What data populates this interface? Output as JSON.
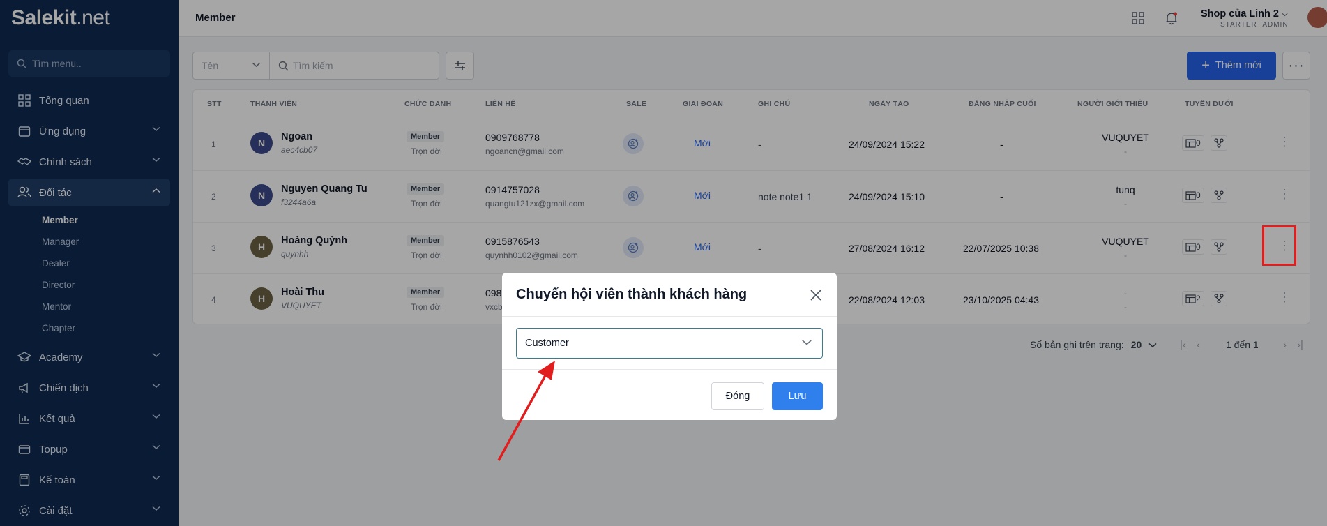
{
  "brand": {
    "logo_main": "Salekit",
    "logo_suffix": ".net"
  },
  "sidebar": {
    "search_placeholder": "Tìm menu..",
    "items": [
      {
        "label": "Tổng quan"
      },
      {
        "label": "Ứng dụng"
      },
      {
        "label": "Chính sách"
      },
      {
        "label": "Đối tác"
      },
      {
        "label": "Academy"
      },
      {
        "label": "Chiến dịch"
      },
      {
        "label": "Kết quả"
      },
      {
        "label": "Topup"
      },
      {
        "label": "Kế toán"
      },
      {
        "label": "Cài đặt"
      }
    ],
    "submenu": [
      "Member",
      "Manager",
      "Dealer",
      "Director",
      "Mentor",
      "Chapter"
    ]
  },
  "header": {
    "title": "Member",
    "shop_name": "Shop của Linh 2",
    "plan": "STARTER",
    "role": "ADMIN"
  },
  "toolbar": {
    "filter_field": "Tên",
    "search_placeholder": "Tìm kiếm",
    "add_label": "Thêm mới"
  },
  "table": {
    "columns": [
      "STT",
      "THÀNH VIÊN",
      "CHỨC DANH",
      "LIÊN HỆ",
      "SALE",
      "GIAI ĐOẠN",
      "GHI CHÚ",
      "NGÀY TẠO",
      "ĐĂNG NHẬP CUỐI",
      "NGƯỜI GIỚI THIỆU",
      "TUYẾN DƯỚI"
    ],
    "rows": [
      {
        "stt": "1",
        "initial": "N",
        "name": "Ngoan",
        "code": "aec4cb07",
        "title": "Member",
        "term": "Trọn đời",
        "phone": "0909768778",
        "email": "ngoancn@gmail.com",
        "stage": "Mới",
        "note": "-",
        "created": "24/09/2024 15:22",
        "last_login": "-",
        "referrer": "VUQUYET",
        "referrer_sub": "-",
        "downline": "0"
      },
      {
        "stt": "2",
        "initial": "N",
        "name": "Nguyen Quang Tu",
        "code": "f3244a6a",
        "title": "Member",
        "term": "Trọn đời",
        "phone": "0914757028",
        "email": "quangtu121zx@gmail.com",
        "stage": "Mới",
        "note": "note note1 1",
        "created": "24/09/2024 15:10",
        "last_login": "-",
        "referrer": "tunq",
        "referrer_sub": "-",
        "downline": "0"
      },
      {
        "stt": "3",
        "initial": "H",
        "name": "Hoàng Quỳnh",
        "code": "quynhh",
        "title": "Member",
        "term": "Trọn đời",
        "phone": "0915876543",
        "email": "quynhh0102@gmail.com",
        "stage": "Mới",
        "note": "-",
        "created": "27/08/2024 16:12",
        "last_login": "22/07/2025 10:38",
        "referrer": "VUQUYET",
        "referrer_sub": "-",
        "downline": "0"
      },
      {
        "stt": "4",
        "initial": "H",
        "name": "Hoài Thu",
        "code": "VUQUYET",
        "title": "Member",
        "term": "Trọn đời",
        "phone": "098",
        "email": "vxcb",
        "stage": "",
        "note": "",
        "created": "22/08/2024 12:03",
        "last_login": "23/10/2025 04:43",
        "referrer": "-",
        "referrer_sub": "-",
        "downline": "2"
      }
    ]
  },
  "pager": {
    "label": "Số bản ghi trên trang:",
    "page_size": "20",
    "range": "1 đến 1"
  },
  "modal": {
    "title": "Chuyển hội viên thành khách hàng",
    "selected": "Customer",
    "close_label": "Đóng",
    "save_label": "Lưu"
  },
  "colors": {
    "sidebar": "#0f2a52",
    "primary": "#2563eb",
    "annotation": "#e11d1d"
  }
}
